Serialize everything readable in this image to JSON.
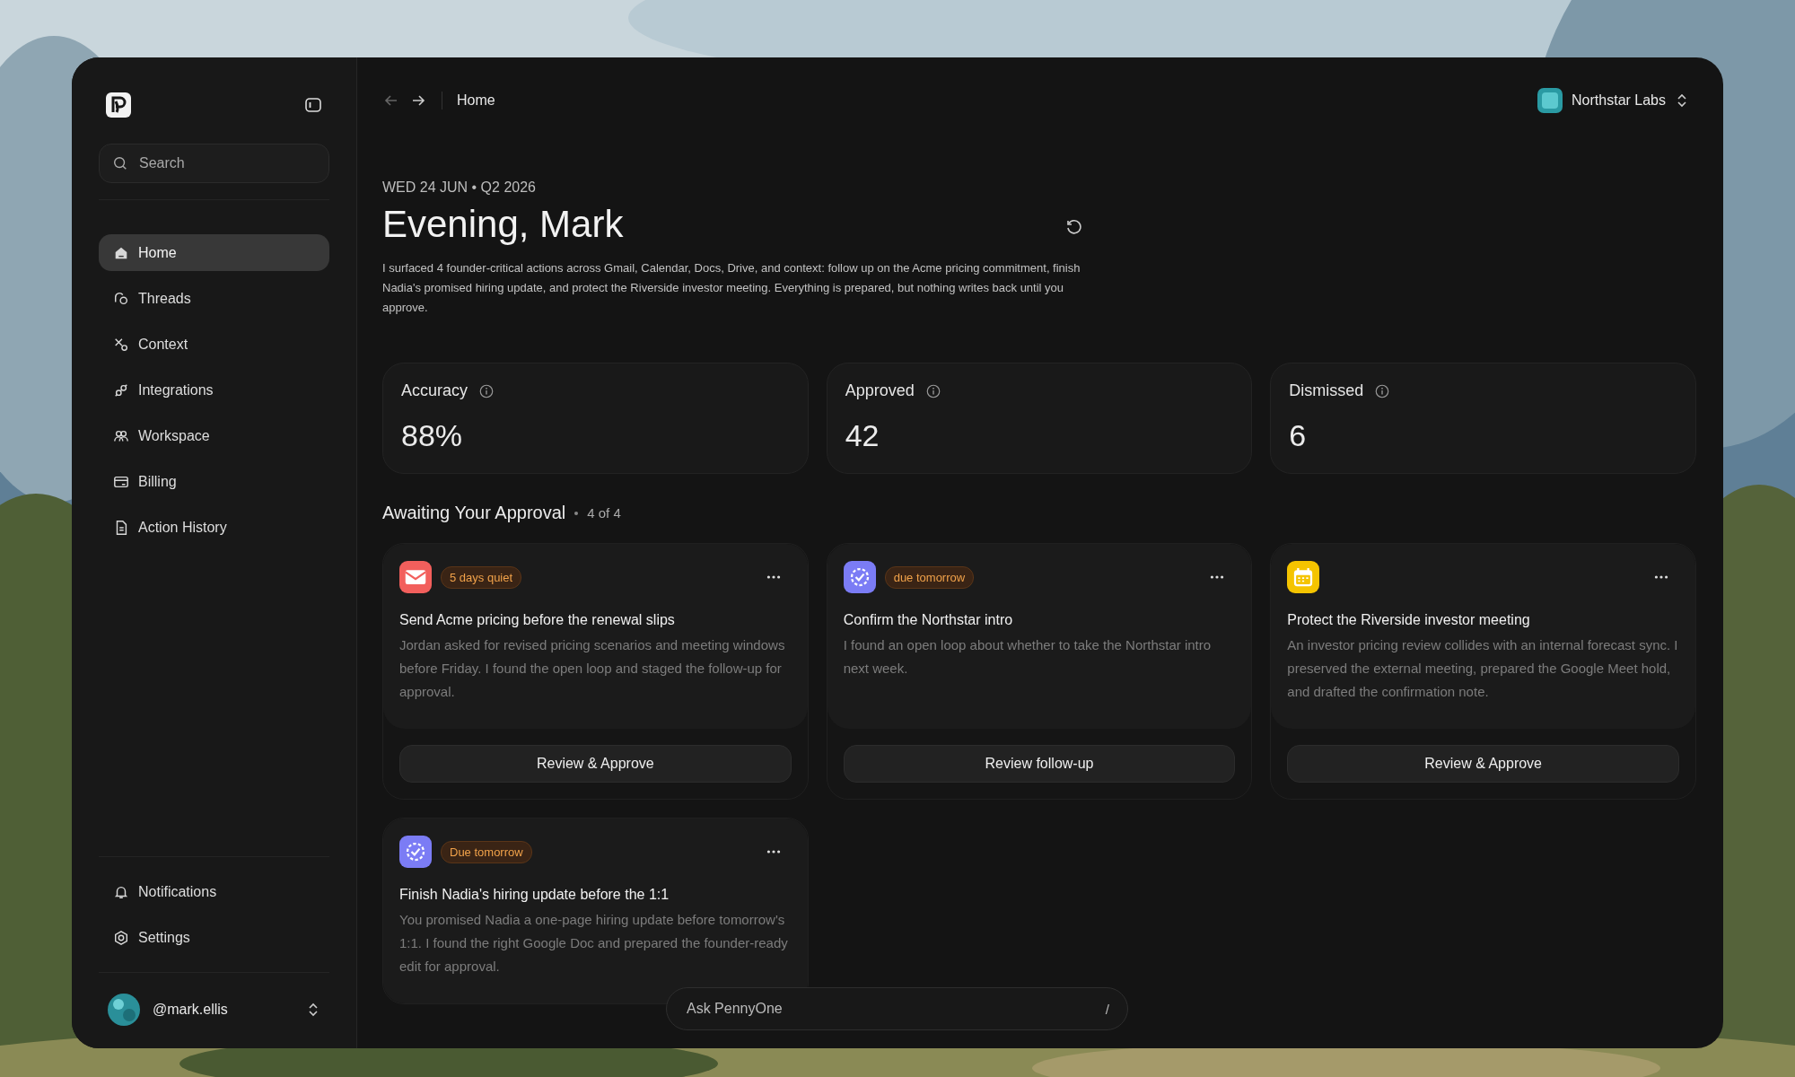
{
  "sidebar": {
    "search": {
      "placeholder": "Search"
    },
    "items": [
      {
        "label": "Home",
        "kind": "home",
        "selected": true
      },
      {
        "label": "Threads",
        "kind": "threads",
        "selected": false
      },
      {
        "label": "Context",
        "kind": "context",
        "selected": false
      },
      {
        "label": "Integrations",
        "kind": "integrations",
        "selected": false
      },
      {
        "label": "Workspace",
        "kind": "workspace",
        "selected": false
      },
      {
        "label": "Billing",
        "kind": "billing",
        "selected": false
      },
      {
        "label": "Action History",
        "kind": "history",
        "selected": false
      }
    ],
    "footer_items": [
      {
        "label": "Notifications",
        "kind": "notifications",
        "selected": false
      },
      {
        "label": "Settings",
        "kind": "settings",
        "selected": false
      }
    ],
    "user": {
      "handle": "@mark.ellis"
    }
  },
  "header": {
    "breadcrumb": "Home",
    "workspace": "Northstar Labs"
  },
  "greeting": {
    "date": "WED 24 JUN • Q2 2026",
    "title": "Evening, Mark",
    "summary": "I surfaced 4 founder-critical actions across Gmail, Calendar, Docs, Drive, and context: follow up on the Acme pricing commitment, finish Nadia's promised hiring update, and protect the Riverside investor meeting. Everything is prepared, but nothing writes back until you approve."
  },
  "stats": [
    {
      "label": "Accuracy",
      "value": "88%"
    },
    {
      "label": "Approved",
      "value": "42"
    },
    {
      "label": "Dismissed",
      "value": "6"
    }
  ],
  "approvals": {
    "title": "Awaiting Your Approval",
    "count": "4 of 4",
    "cards": [
      {
        "kind": "mail",
        "color": "#f25f5c",
        "badge": "5 days quiet",
        "title": "Send Acme pricing before the renewal slips",
        "body": "Jordan asked for revised pricing scenarios and meeting windows before Friday. I found the open loop and staged the follow-up for approval.",
        "action": "Review & Approve"
      },
      {
        "kind": "task",
        "color": "#7b7cf5",
        "badge": "due tomorrow",
        "title": "Confirm the Northstar intro",
        "body": "I found an open loop about whether to take the Northstar intro next week.",
        "action": "Review follow-up"
      },
      {
        "kind": "event",
        "color": "#f5c400",
        "title": "Protect the Riverside investor meeting",
        "body": "An investor pricing review collides with an internal forecast sync. I preserved the external meeting, prepared the Google Meet hold, and drafted the confirmation note.",
        "action": "Review & Approve"
      },
      {
        "kind": "task",
        "color": "#7b7cf5",
        "badge": "Due tomorrow",
        "title": "Finish Nadia's hiring update before the 1:1",
        "body": "You promised Nadia a one-page hiring update before tomorrow's 1:1. I found the right Google Doc and prepared the founder-ready edit for approval."
      }
    ]
  },
  "ask": {
    "placeholder": "Ask PennyOne",
    "shortcut": "/"
  }
}
